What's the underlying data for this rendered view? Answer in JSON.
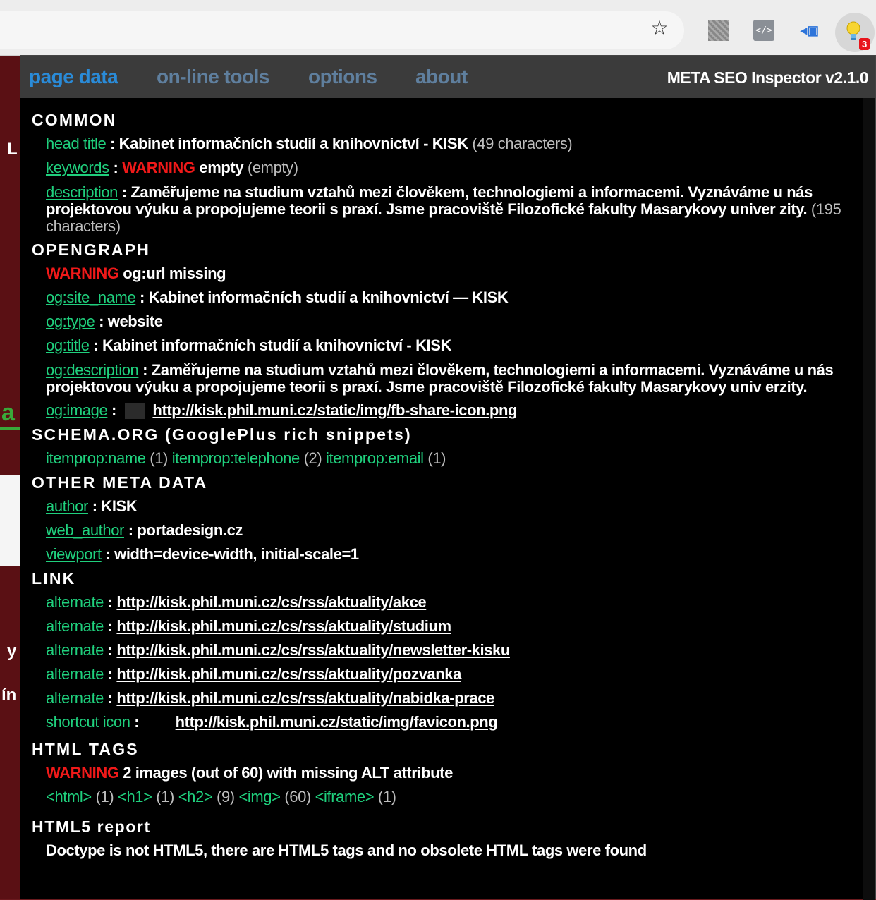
{
  "nav": {
    "tabs": [
      "page data",
      "on-line tools",
      "options",
      "about"
    ],
    "version": "META SEO Inspector v2.1.0"
  },
  "extension_badge": "3",
  "background_fragments": [
    "L",
    "a",
    "y",
    "ín"
  ],
  "common": {
    "title": "COMMON",
    "head_title_key": "head title",
    "head_title_value": "Kabinet informačních studií a knihovnictví - KISK",
    "head_title_count": "(49 characters)",
    "keywords_key": "keywords",
    "keywords_warning": "WARNING",
    "keywords_value": "empty",
    "keywords_note": "(empty)",
    "description_key": "description",
    "description_value": "Zaměřujeme na studium vztahů mezi člověkem, technologiemi a informacemi. Vyznáváme u nás projektovou výuku a propojujeme teorii s praxí. Jsme pracoviště Filozofické fakulty Masarykovy univer zity.",
    "description_count": "(195 characters)"
  },
  "opengraph": {
    "title": "OPENGRAPH",
    "warning": "WARNING",
    "warning_text": "og:url missing",
    "site_name_key": "og:site_name",
    "site_name_value": "Kabinet informačních studií a knihovnictví — KISK",
    "type_key": "og:type",
    "type_value": "website",
    "og_title_key": "og:title",
    "og_title_value": "Kabinet informačních studií a knihovnictví - KISK",
    "description_key": "og:description",
    "description_value": "Zaměřujeme na studium vztahů mezi člověkem, technologiemi a informacemi. Vyznáváme u nás projektovou výuku a propojujeme teorii s praxí. Jsme pracoviště Filozofické fakulty Masarykovy univ erzity.",
    "image_key": "og:image",
    "image_url": "http://kisk.phil.muni.cz/static/img/fb-share-icon.png"
  },
  "schema": {
    "title": "SCHEMA.ORG (GooglePlus rich snippets)",
    "items": [
      {
        "key": "itemprop:name",
        "count": "(1)"
      },
      {
        "key": "itemprop:telephone",
        "count": "(2)"
      },
      {
        "key": "itemprop:email",
        "count": "(1)"
      }
    ]
  },
  "other_meta": {
    "title": "OTHER META DATA",
    "author_key": "author",
    "author_value": "KISK",
    "web_author_key": "web_author",
    "web_author_value": "portadesign.cz",
    "viewport_key": "viewport",
    "viewport_value": "width=device-width, initial-scale=1"
  },
  "link": {
    "title": "LINK",
    "alternate_key": "alternate",
    "alternates": [
      "http://kisk.phil.muni.cz/cs/rss/aktuality/akce",
      "http://kisk.phil.muni.cz/cs/rss/aktuality/studium",
      "http://kisk.phil.muni.cz/cs/rss/aktuality/newsletter-kisku",
      "http://kisk.phil.muni.cz/cs/rss/aktuality/pozvanka",
      "http://kisk.phil.muni.cz/cs/rss/aktuality/nabidka-prace"
    ],
    "shortcut_key": "shortcut icon",
    "shortcut_url": "http://kisk.phil.muni.cz/static/img/favicon.png"
  },
  "html_tags": {
    "title": "HTML TAGS",
    "warning": "WARNING",
    "warning_text": "2 images (out of 60) with missing ALT attribute",
    "tags": [
      {
        "tag": "<html>",
        "count": "(1)"
      },
      {
        "tag": "<h1>",
        "count": "(1)"
      },
      {
        "tag": "<h2>",
        "count": "(9)"
      },
      {
        "tag": "<img>",
        "count": "(60)"
      },
      {
        "tag": "<iframe>",
        "count": "(1)"
      }
    ]
  },
  "html5": {
    "title": "HTML5 report",
    "partial_text": "Doctype is not HTML5, there are HTML5 tags and no obsolete HTML tags were found"
  },
  "colors": {
    "accent_green": "#1fd07d",
    "warning_red": "#f01919",
    "active_tab": "#2a8bd8",
    "inactive_tab": "#5f7f9e"
  }
}
